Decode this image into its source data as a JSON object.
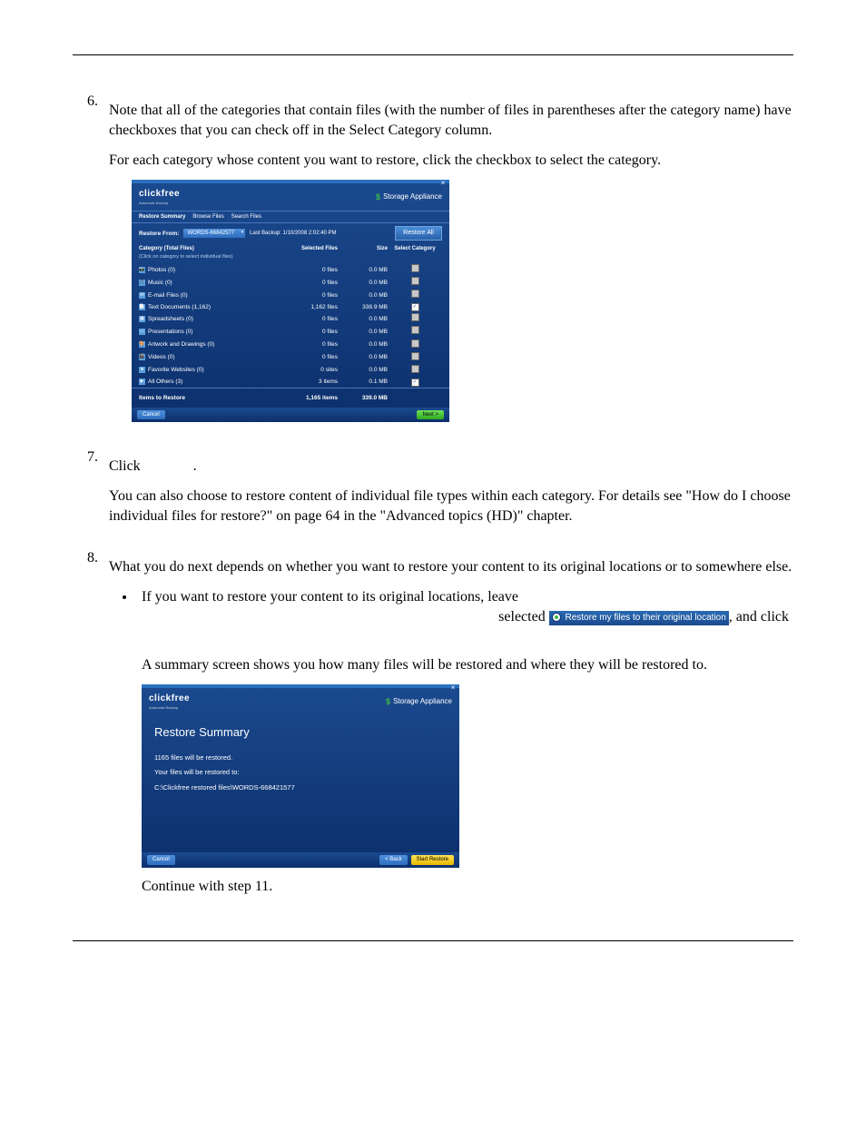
{
  "step6": {
    "num": "6.",
    "para1": "Note that all of the categories that contain files (with the number of files in parentheses after the category name) have checkboxes that you can check off in the Select Category column.",
    "para2": "For each category whose content you want to restore, click the checkbox to select the category."
  },
  "window1": {
    "brand": "clickfree",
    "brand_sub": "Automatic Backup",
    "brand_logo": "Storage Appliance",
    "tabs": [
      "Restore Summary",
      "Browse Files",
      "Search Files"
    ],
    "restore_from_label": "Restore From:",
    "restore_from_value": "WORDS-66842577",
    "last_backup": "Last Backup: 1/10/2008 2:02:40 PM",
    "restore_all_btn": "Restore All",
    "col_header_main": "Category (Total Files)",
    "hint": "(Click on category to select individual files)",
    "col_selected": "Selected Files",
    "col_size": "Size",
    "col_select_cat": "Select Category",
    "categories": [
      {
        "icon": "📷",
        "name": "Photos (0)",
        "files": "0 files",
        "size": "0.0 MB",
        "checked": false
      },
      {
        "icon": "🎵",
        "name": "Music (0)",
        "files": "0 files",
        "size": "0.0 MB",
        "checked": false
      },
      {
        "icon": "✉",
        "name": "E-mail Files (0)",
        "files": "0 files",
        "size": "0.0 MB",
        "checked": false
      },
      {
        "icon": "📄",
        "name": "Text Documents (1,162)",
        "files": "1,162 files",
        "size": "338.9 MB",
        "checked": true
      },
      {
        "icon": "▦",
        "name": "Spreadsheets (0)",
        "files": "0 files",
        "size": "0.0 MB",
        "checked": false
      },
      {
        "icon": "▭",
        "name": "Presentations (0)",
        "files": "0 files",
        "size": "0.0 MB",
        "checked": false
      },
      {
        "icon": "🎨",
        "name": "Artwork and Drawings (0)",
        "files": "0 files",
        "size": "0.0 MB",
        "checked": false
      },
      {
        "icon": "🎬",
        "name": "Videos (0)",
        "files": "0 files",
        "size": "0.0 MB",
        "checked": false
      },
      {
        "icon": "★",
        "name": "Favorite Websites (0)",
        "files": "0 sites",
        "size": "0.0 MB",
        "checked": false
      },
      {
        "icon": "▶",
        "name": "All Others (3)",
        "files": "3 items",
        "size": "0.1 MB",
        "checked": true
      }
    ],
    "items_to_restore_label": "Items to Restore",
    "items_to_restore_count": "1,165 items",
    "items_to_restore_size": "339.0 MB",
    "cancel_btn": "Cancel",
    "next_btn": "Next >"
  },
  "step7": {
    "num": "7.",
    "text_a": "Click",
    "text_b": ".",
    "para2": "You can also choose to restore content of individual file types within each category. For details see \"How do I choose individual files for restore?\" on page 64 in the \"Advanced topics (HD)\" chapter."
  },
  "step8": {
    "num": "8.",
    "para1": "What you do next depends on whether you want to restore your content to its original locations or to somewhere else.",
    "bullet1_text1": "If you want to restore your content to its original locations, leave",
    "bullet1_text2": "selected",
    "radio_label": "Restore my files to their original location",
    "bullet1_text3a": ", and click",
    "summary_intro": "A summary screen shows you how many files will be restored and where they will be restored to.",
    "continue_text": "Continue with step 11."
  },
  "window2": {
    "brand": "clickfree",
    "brand_sub": "Automatic Backup",
    "brand_logo": "Storage Appliance",
    "title": "Restore Summary",
    "line1": "1165 files will be restored.",
    "line2": "Your files will be restored to:",
    "line3": "C:\\Clickfree restored files\\WORDS-668421577",
    "cancel_btn": "Cancel",
    "back_btn": "< Back",
    "start_btn": "Start Restore"
  }
}
